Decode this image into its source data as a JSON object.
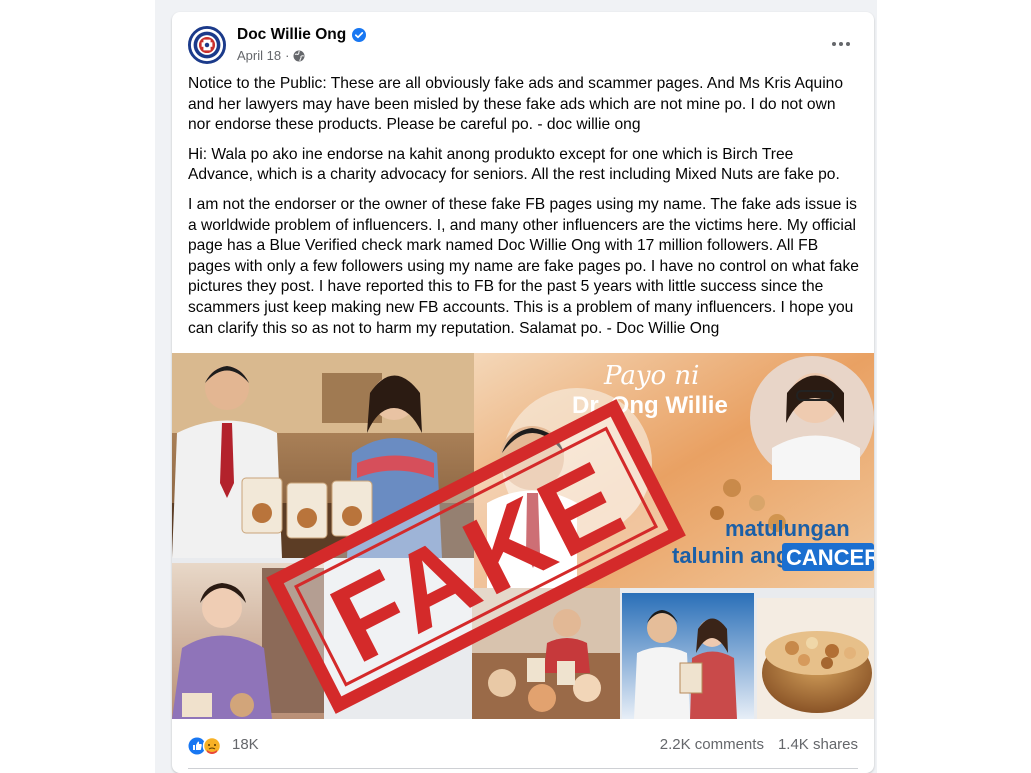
{
  "post": {
    "author": "Doc Willie Ong",
    "date": "April 18",
    "date_sep": "·",
    "paragraphs": [
      "Notice to the Public: These are all obviously fake ads and scammer pages. And Ms Kris Aquino and her lawyers may have been misled by these fake ads which are not mine po. I do not own nor endorse these products. Please be careful po. - doc willie ong",
      "Hi: Wala po ako ine endorse na kahit anong produkto except for one which is Birch Tree Advance, which is a charity advocacy for seniors. All the rest including Mixed Nuts are fake po.",
      "I am not the endorser or the owner of these fake FB pages using my name. The fake ads issue is a worldwide problem of influencers. I, and many other influencers are the victims here. My official page has a Blue Verified check mark named Doc Willie Ong with 17 million followers. All FB pages with only a few followers using my name are fake pages po. I have no control on what fake pictures they post. I have reported this to FB for the past 5 years with little success since the scammers just keep making new FB accounts. This is a problem of many influencers. I hope you can clarify this so as not to harm my reputation. Salamat po. - Doc Willie Ong"
    ]
  },
  "media": {
    "stamp_text": "FAKE",
    "ad_title_1": "Payo ni",
    "ad_title_2": "Dr. Ong Willie",
    "ad_line_1": "matulungan",
    "ad_line_2": "talunin ang",
    "ad_highlight": "CANCER"
  },
  "stats": {
    "reaction_count": "18K",
    "comments": "2.2K comments",
    "shares": "1.4K shares"
  },
  "colors": {
    "brand_blue": "#1877f2",
    "stamp_red": "#d42a2a",
    "meta_gray": "#65676b"
  }
}
